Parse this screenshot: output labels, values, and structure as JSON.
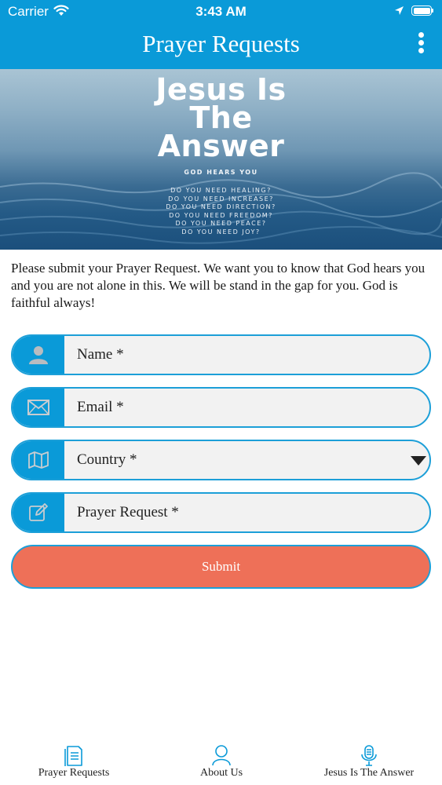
{
  "status_bar": {
    "carrier": "Carrier",
    "time": "3:43 AM"
  },
  "header": {
    "title": "Prayer Requests"
  },
  "banner": {
    "title_lines": [
      "Jesus Is",
      "The",
      "Answer"
    ],
    "subtitle": "GOD HEARS YOU",
    "lines": [
      "DO YOU NEED HEALING?",
      "DO YOU NEED INCREASE?",
      "DO YOU NEED DIRECTION?",
      "DO YOU NEED FREEDOM?",
      "DO YOU NEED PEACE?",
      "DO YOU NEED JOY?"
    ]
  },
  "intro": "Please submit your Prayer Request. We want you to know that God hears you and you are not alone in this. We will be stand in the gap for you. God is faithful always!",
  "form": {
    "name_placeholder": "Name *",
    "email_placeholder": "Email *",
    "country_placeholder": "Country *",
    "prayer_placeholder": "Prayer Request *",
    "submit_label": "Submit"
  },
  "tabs": [
    {
      "label": "Prayer Requests",
      "icon": "document-icon"
    },
    {
      "label": "About Us",
      "icon": "person-icon"
    },
    {
      "label": "Jesus Is The Answer",
      "icon": "microphone-icon"
    }
  ],
  "colors": {
    "accent": "#0a9ad8",
    "submit": "#ee7058",
    "field_bg": "#f2f2f2"
  }
}
